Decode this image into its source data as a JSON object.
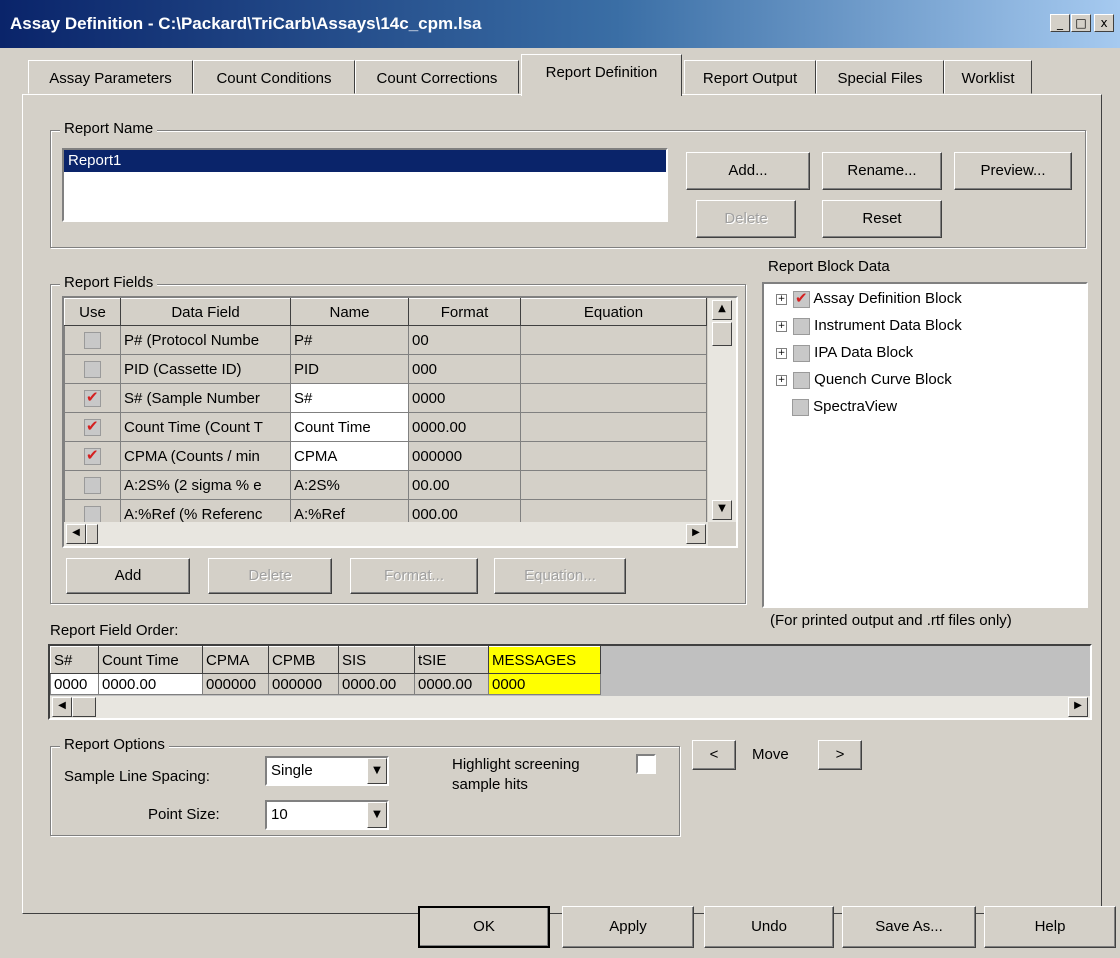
{
  "window": {
    "title": "Assay Definition - C:\\Packard\\TriCarb\\Assays\\14c_cpm.lsa",
    "min": "_",
    "max": "□",
    "close": "x"
  },
  "tabs": [
    "Assay Parameters",
    "Count Conditions",
    "Count Corrections",
    "Report Definition",
    "Report Output",
    "Special Files",
    "Worklist"
  ],
  "report_name": {
    "legend": "Report Name",
    "items": [
      "Report1"
    ],
    "buttons": {
      "add": "Add...",
      "rename": "Rename...",
      "preview": "Preview...",
      "delete": "Delete",
      "reset": "Reset"
    }
  },
  "report_fields": {
    "legend": "Report Fields",
    "headers": [
      "Use",
      "Data Field",
      "Name",
      "Format",
      "Equation"
    ],
    "rows": [
      {
        "use": false,
        "field": "P# (Protocol Numbe",
        "name": "P#",
        "format": "00",
        "equation": ""
      },
      {
        "use": false,
        "field": "PID (Cassette ID)",
        "name": "PID",
        "format": "000",
        "equation": ""
      },
      {
        "use": true,
        "field": "S# (Sample Number",
        "name": "S#",
        "format": "0000",
        "equation": ""
      },
      {
        "use": true,
        "field": "Count Time (Count T",
        "name": "Count Time",
        "format": "0000.00",
        "equation": ""
      },
      {
        "use": true,
        "field": "CPMA (Counts / min",
        "name": "CPMA",
        "format": "000000",
        "equation": ""
      },
      {
        "use": false,
        "field": "A:2S% (2 sigma % e",
        "name": "A:2S%",
        "format": "00.00",
        "equation": ""
      },
      {
        "use": false,
        "field": "A:%Ref (% Referenc",
        "name": "A:%Ref",
        "format": "000.00",
        "equation": ""
      }
    ],
    "buttons": {
      "add": "Add",
      "delete": "Delete",
      "format": "Format...",
      "equation": "Equation..."
    }
  },
  "report_block": {
    "legend": "Report Block Data",
    "items": [
      {
        "label": "Assay Definition Block",
        "checked": true,
        "expandable": true
      },
      {
        "label": "Instrument Data Block",
        "checked": false,
        "expandable": true
      },
      {
        "label": "IPA Data Block",
        "checked": false,
        "expandable": true
      },
      {
        "label": "Quench Curve Block",
        "checked": false,
        "expandable": true
      },
      {
        "label": "SpectraView",
        "checked": false,
        "expandable": false
      }
    ],
    "note": "(For printed output and .rtf files only)"
  },
  "field_order": {
    "label": "Report Field Order:",
    "headers": [
      "S#",
      "Count Time",
      "CPMA",
      "CPMB",
      "SIS",
      "tSIE",
      "MESSAGES"
    ],
    "values": [
      "0000",
      "0000.00",
      "000000",
      "000000",
      "0000.00",
      "0000.00",
      "0000"
    ],
    "highlight_color": "#ffff00"
  },
  "report_options": {
    "legend": "Report Options",
    "spacing_label": "Sample Line Spacing:",
    "spacing_value": "Single",
    "point_label": "Point Size:",
    "point_value": "10",
    "highlight_label_1": "Highlight screening",
    "highlight_label_2": "sample hits",
    "highlight_checked": false
  },
  "move": {
    "label": "Move",
    "left": "<",
    "right": ">"
  },
  "footer": {
    "ok": "OK",
    "apply": "Apply",
    "undo": "Undo",
    "save_as": "Save As...",
    "help": "Help"
  },
  "colors": {
    "title_start": "#0a246a",
    "selection": "#0a246a",
    "check": "#d42020"
  }
}
